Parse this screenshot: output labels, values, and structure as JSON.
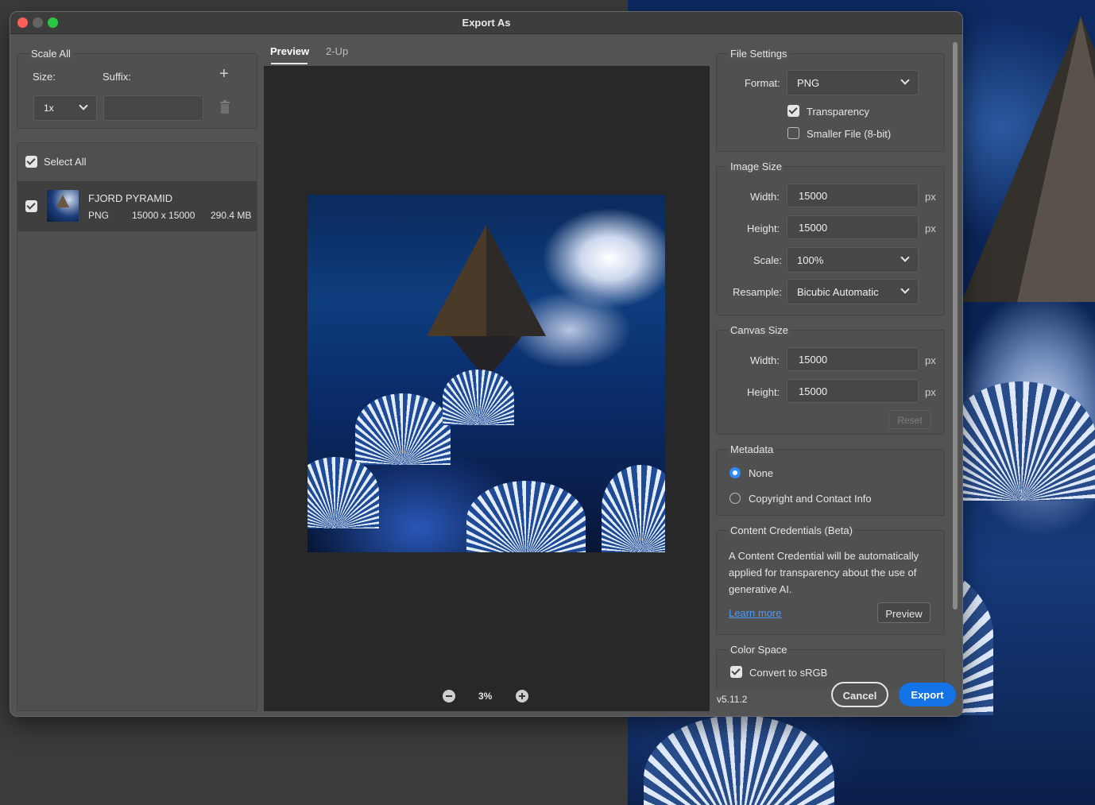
{
  "window": {
    "title": "Export As"
  },
  "scale_all": {
    "heading": "Scale All",
    "size_label": "Size:",
    "suffix_label": "Suffix:",
    "size_value": "1x",
    "suffix_value": ""
  },
  "select_all": {
    "label": "Select All",
    "checked": true
  },
  "asset": {
    "name": "FJORD PYRAMID",
    "format": "PNG",
    "dimensions": "15000 x 15000",
    "size": "290.4 MB",
    "checked": true
  },
  "tabs": [
    {
      "label": "Preview",
      "active": true
    },
    {
      "label": "2-Up",
      "active": false
    }
  ],
  "zoom": {
    "level": "3%"
  },
  "file_settings": {
    "heading": "File Settings",
    "format_label": "Format:",
    "format_value": "PNG",
    "transparency_label": "Transparency",
    "transparency_checked": true,
    "smaller_file_label": "Smaller File (8-bit)",
    "smaller_file_checked": false
  },
  "image_size": {
    "heading": "Image Size",
    "width_label": "Width:",
    "width_value": "15000",
    "height_label": "Height:",
    "height_value": "15000",
    "unit": "px",
    "scale_label": "Scale:",
    "scale_value": "100%",
    "resample_label": "Resample:",
    "resample_value": "Bicubic Automatic"
  },
  "canvas_size": {
    "heading": "Canvas Size",
    "width_label": "Width:",
    "width_value": "15000",
    "height_label": "Height:",
    "height_value": "15000",
    "unit": "px",
    "reset_label": "Reset"
  },
  "metadata": {
    "heading": "Metadata",
    "options": [
      {
        "label": "None",
        "selected": true
      },
      {
        "label": "Copyright and Contact Info",
        "selected": false
      }
    ]
  },
  "content_credentials": {
    "heading": "Content Credentials (Beta)",
    "line1": "A Content Credential will be automatically",
    "line2": "applied for transparency about the use of",
    "line3": "generative AI.",
    "learn_more": "Learn more",
    "preview_button": "Preview"
  },
  "color_space": {
    "heading": "Color Space",
    "convert_label": "Convert to sRGB",
    "convert_checked": true
  },
  "footer": {
    "version": "v5.11.2",
    "cancel": "Cancel",
    "export": "Export"
  },
  "colors": {
    "accent": "#1473e6",
    "radio_selected": "#2f8bf5",
    "dialog_bg": "#535353",
    "preview_bg": "#282828"
  }
}
